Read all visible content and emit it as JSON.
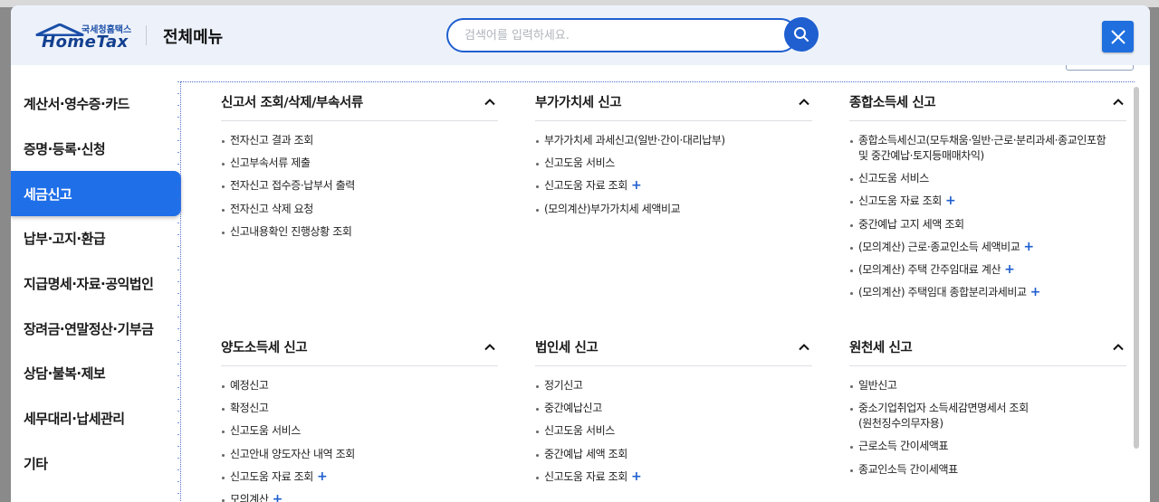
{
  "header": {
    "logo_sub": "국세청홈택스",
    "logo_main": "HomeTax",
    "title": "전체메뉴",
    "search_placeholder": "검색어를 입력하세요."
  },
  "sidebar": {
    "items": [
      {
        "label": "계산서·영수증·카드",
        "active": false
      },
      {
        "label": "증명·등록·신청",
        "active": false
      },
      {
        "label": "세금신고",
        "active": true
      },
      {
        "label": "납부·고지·환급",
        "active": false
      },
      {
        "label": "지급명세·자료·공익법인",
        "active": false
      },
      {
        "label": "장려금·연말정산·기부금",
        "active": false
      },
      {
        "label": "상담·불복·제보",
        "active": false
      },
      {
        "label": "세무대리·납세관리",
        "active": false
      },
      {
        "label": "기타",
        "active": false
      }
    ]
  },
  "sections": [
    {
      "title": "신고서 조회/삭제/부속서류",
      "items": [
        {
          "label": "전자신고 결과 조회",
          "plus": false
        },
        {
          "label": "신고부속서류 제출",
          "plus": false
        },
        {
          "label": "전자신고 접수증·납부서 출력",
          "plus": false
        },
        {
          "label": "전자신고 삭제 요청",
          "plus": false
        },
        {
          "label": "신고내용확인 진행상황 조회",
          "plus": false
        }
      ]
    },
    {
      "title": "부가가치세 신고",
      "items": [
        {
          "label": "부가가치세 과세신고(일반·간이·대리납부)",
          "plus": false
        },
        {
          "label": "신고도움 서비스",
          "plus": false
        },
        {
          "label": "신고도움 자료 조회",
          "plus": true
        },
        {
          "label": "(모의계산)부가가치세 세액비교",
          "plus": false
        }
      ]
    },
    {
      "title": "종합소득세 신고",
      "items": [
        {
          "label": "종합소득세신고(모두채움·일반·근로·분리과세·종교인포함",
          "label2": "및 중간예납·토지등매매차익)",
          "plus": false
        },
        {
          "label": "신고도움 서비스",
          "plus": false
        },
        {
          "label": "신고도움 자료 조회",
          "plus": true
        },
        {
          "label": "중간예납 고지 세액 조회",
          "plus": false
        },
        {
          "label": "(모의계산) 근로·종교인소득 세액비교",
          "plus": true
        },
        {
          "label": "(모의계산) 주택 간주임대료 계산",
          "plus": true
        },
        {
          "label": "(모의계산) 주택임대 종합분리과세비교",
          "plus": true
        }
      ]
    },
    {
      "title": "양도소득세 신고",
      "items": [
        {
          "label": "예정신고",
          "plus": false
        },
        {
          "label": "확정신고",
          "plus": false
        },
        {
          "label": "신고도움 서비스",
          "plus": false
        },
        {
          "label": "신고안내 양도자산 내역 조회",
          "plus": false
        },
        {
          "label": "신고도움 자료 조회",
          "plus": true
        },
        {
          "label": "모의계산",
          "plus": true
        }
      ]
    },
    {
      "title": "법인세 신고",
      "items": [
        {
          "label": "정기신고",
          "plus": false
        },
        {
          "label": "중간예납신고",
          "plus": false
        },
        {
          "label": "신고도움 서비스",
          "plus": false
        },
        {
          "label": "중간예납 세액 조회",
          "plus": false
        },
        {
          "label": "신고도움 자료 조회",
          "plus": true
        }
      ]
    },
    {
      "title": "원천세 신고",
      "items": [
        {
          "label": "일반신고",
          "plus": false
        },
        {
          "label": "중소기업취업자 소득세감면명세서 조회",
          "label2": "(원천징수의무자용)",
          "plus": false
        },
        {
          "label": "근로소득 간이세액표",
          "plus": false
        },
        {
          "label": "종교인소득 간이세액표",
          "plus": false
        }
      ]
    }
  ],
  "icons": {
    "search": "search-icon",
    "close": "close-icon",
    "chevron": "chevron-up-icon"
  },
  "colors": {
    "accent": "#1f5fd0",
    "active_bg": "#1f6fe8",
    "header_bg": "#edf2fa"
  }
}
